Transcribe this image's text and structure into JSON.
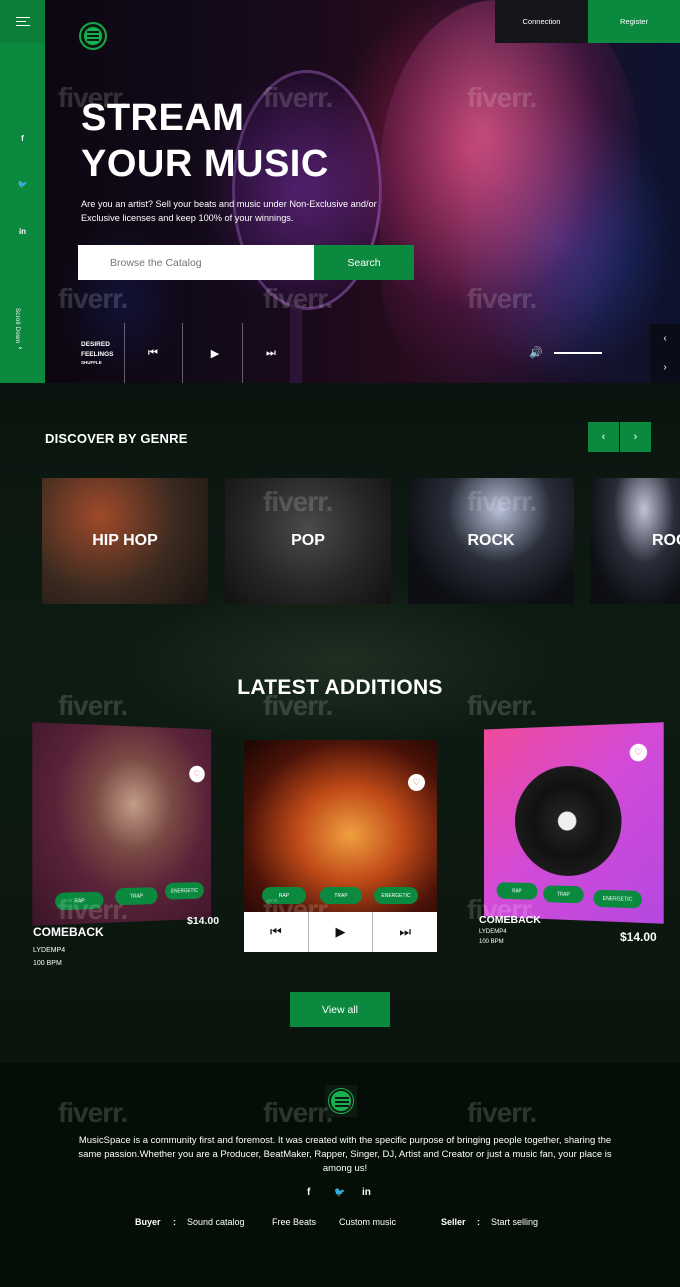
{
  "header": {
    "connection_label": "Connection",
    "register_label": "Register"
  },
  "sidebar": {
    "social": [
      "f",
      "🐦",
      "in"
    ],
    "scroll_label": "Scroll Down"
  },
  "hero": {
    "title_line1": "STREAM",
    "title_line2": "YOUR MUSIC",
    "description": "Are you an artist? Sell your beats and music under Non-Exclusive and/or Exclusive licenses and keep 100% of your winnings.",
    "search_placeholder": "Browse the Catalog",
    "search_button": "Search"
  },
  "player": {
    "track_line1": "DESIRED",
    "track_line2": "FEELINGS",
    "track_sub": "SHUFFLE",
    "prev_icon": "prev-icon",
    "play_icon": "play-icon",
    "next_icon": "next-icon",
    "volume_icon": "volume-icon"
  },
  "genres": {
    "title": "DISCOVER BY GENRE",
    "items": [
      "HIP HOP",
      "POP",
      "ROCK",
      "ROCK"
    ]
  },
  "latest": {
    "title": "LATEST ADDITIONS",
    "cards": [
      {
        "title": "COMEBACK",
        "artist": "LYDEMP4",
        "bpm": "100 BPM",
        "price": "$14.00",
        "tags": [
          "RAP",
          "TRAP",
          "ENERGETIC"
        ]
      },
      {
        "title": "",
        "artist": "",
        "bpm": "",
        "price": "",
        "tags": [
          "RAP",
          "TRAP",
          "ENERGETIC"
        ]
      },
      {
        "title": "COMEBACK",
        "artist": "LYDEMP4",
        "bpm": "100 BPM",
        "price": "$14.00",
        "tags": [
          "RAP",
          "TRAP",
          "ENERGETIC"
        ]
      }
    ],
    "view_all_label": "View all"
  },
  "footer": {
    "text": "MusicSpace is a community first and foremost. It was created with the specific purpose of bringing people together, sharing the same passion.Whether you are a Producer, BeatMaker, Rapper, Singer, DJ, Artist and Creator or just a music fan, your place is among us!",
    "social": [
      "f",
      "🐦",
      "in"
    ],
    "buyer_label": "Buyer",
    "seller_label": "Seller",
    "sep": ":",
    "links": [
      "Sound catalog",
      "Free Beats",
      "Custom music"
    ],
    "seller_links": [
      "Start selling"
    ]
  },
  "watermark": "fiverr.",
  "colors": {
    "accent": "#0b8a3f",
    "background": "#0a140e"
  }
}
